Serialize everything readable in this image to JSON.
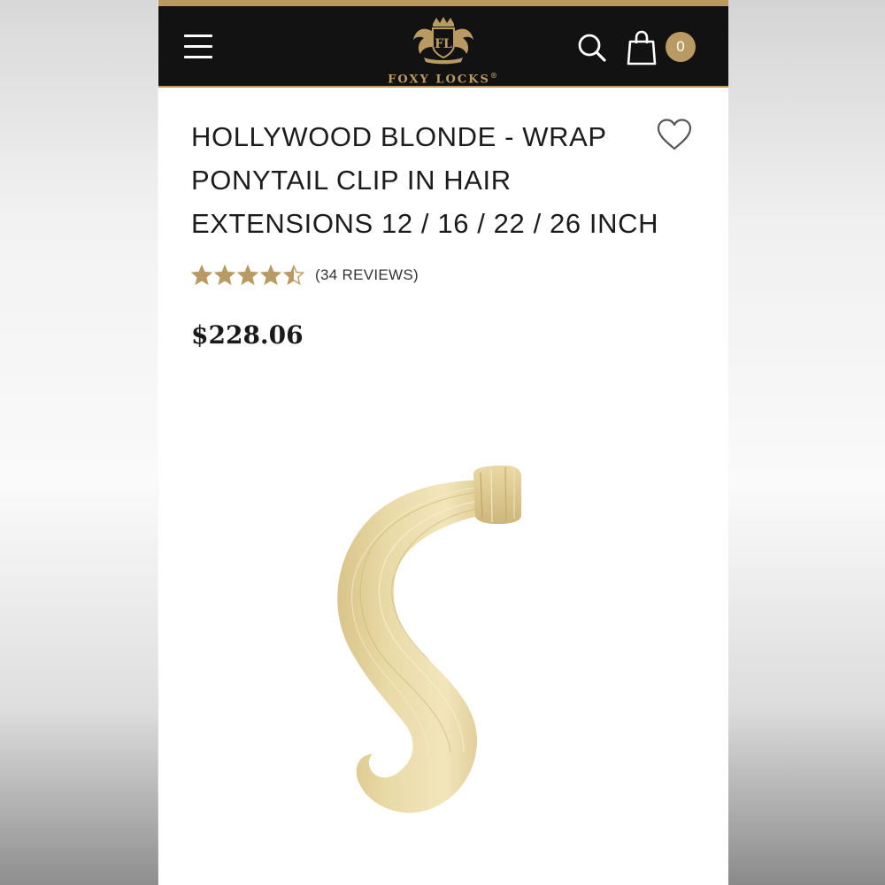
{
  "brand": {
    "name": "FOXY LOCKS",
    "trademark": "®",
    "monogram": "FL",
    "gold_color": "#b99a62",
    "header_bg": "#121212"
  },
  "header": {
    "menu_icon": "hamburger-menu-icon",
    "search_icon": "search-icon",
    "cart_icon": "shopping-bag-icon",
    "cart_count": "0"
  },
  "product": {
    "title": "HOLLYWOOD BLONDE - WRAP PONYTAIL CLIP IN HAIR EXTENSIONS 12 / 16 / 22 / 26 INCH",
    "rating": 4.5,
    "rating_max": 5,
    "reviews_label": "(34 REVIEWS)",
    "price": "$228.06",
    "wishlist_icon": "heart-outline-icon",
    "image_subject": "blonde wrap ponytail hair extension",
    "hair_color": "#e9d9a6"
  }
}
